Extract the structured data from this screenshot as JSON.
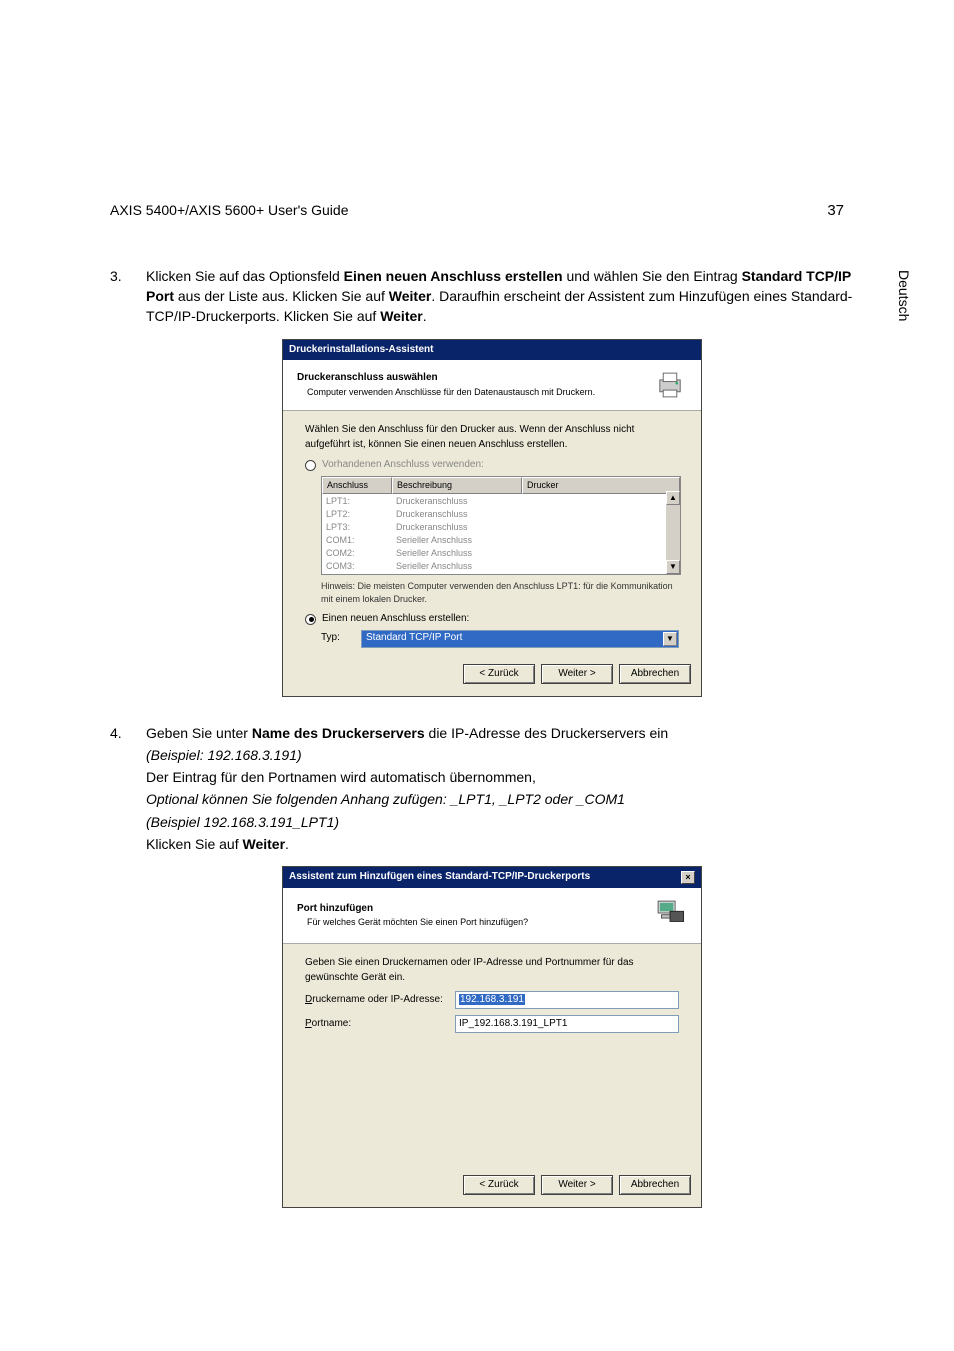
{
  "header": {
    "title": "AXIS 5400+/AXIS 5600+ User's Guide",
    "page_number": "37",
    "side_label": "Deutsch"
  },
  "step3": {
    "number": "3.",
    "text_before_bold1": "Klicken Sie auf das Optionsfeld ",
    "bold1": "Einen neuen Anschluss erstellen",
    "text_mid1": " und wählen Sie den Eintrag ",
    "bold2": "Standard TCP/IP Port",
    "text_mid2": " aus der Liste aus. Klicken Sie auf ",
    "bold3": "Weiter",
    "text_mid3": ". Daraufhin erscheint der Assistent zum Hinzufügen eines Standard-TCP/IP-Druckerports. Klicken Sie auf ",
    "bold4": "Weiter",
    "text_end": "."
  },
  "dialog1": {
    "title": "Druckerinstallations-Assistent",
    "heading": "Druckeranschluss auswählen",
    "subheading": "Computer verwenden Anschlüsse für den Datenaustausch mit Druckern.",
    "intro": "Wählen Sie den Anschluss für den Drucker aus. Wenn der Anschluss nicht aufgeführt ist, können Sie einen neuen Anschluss erstellen.",
    "radio_existing": "Vorhandenen Anschluss verwenden:",
    "table": {
      "col1": "Anschluss",
      "col2": "Beschreibung",
      "col3": "Drucker",
      "rows": [
        {
          "c1": "LPT1:",
          "c2": "Druckeranschluss"
        },
        {
          "c1": "LPT2:",
          "c2": "Druckeranschluss"
        },
        {
          "c1": "LPT3:",
          "c2": "Druckeranschluss"
        },
        {
          "c1": "COM1:",
          "c2": "Serieller Anschluss"
        },
        {
          "c1": "COM2:",
          "c2": "Serieller Anschluss"
        },
        {
          "c1": "COM3:",
          "c2": "Serieller Anschluss"
        }
      ]
    },
    "hint": "Hinweis: Die meisten Computer verwenden den Anschluss LPT1: für die Kommunikation mit einem lokalen Drucker.",
    "radio_new": "Einen neuen Anschluss erstellen:",
    "type_label": "Typ:",
    "type_value": "Standard TCP/IP Port",
    "btn_back": "< Zurück",
    "btn_next": "Weiter >",
    "btn_cancel": "Abbrechen"
  },
  "step4": {
    "number": "4.",
    "line1_a": "Geben Sie unter ",
    "line1_bold": "Name des Druckerservers",
    "line1_b": " die IP-Adresse des Druckerservers ein",
    "line2_italic": "(Beispiel: 192.168.3.191)",
    "line3": "Der Eintrag für den Portnamen wird automatisch übernommen,",
    "line4_italic": "Optional können Sie folgenden Anhang zufügen: _LPT1, _LPT2 oder _COM1",
    "line5_italic": "(Beispiel 192.168.3.191_LPT1)",
    "line6_a": "Klicken Sie auf ",
    "line6_bold": "Weiter",
    "line6_b": "."
  },
  "dialog2": {
    "title": "Assistent zum Hinzufügen eines Standard-TCP/IP-Druckerports",
    "heading": "Port hinzufügen",
    "subheading": "Für welches Gerät möchten Sie einen Port hinzufügen?",
    "intro": "Geben Sie einen Druckernamen oder IP-Adresse und Portnummer für das gewünschte Gerät ein.",
    "label_ip_u": "D",
    "label_ip_rest": "ruckername oder IP-Adresse:",
    "ip_value": "192.168.3.191",
    "label_port_u": "P",
    "label_port_rest": "ortname:",
    "port_value": "IP_192.168.3.191_LPT1",
    "btn_back": "< Zurück",
    "btn_next": "Weiter >",
    "btn_cancel": "Abbrechen"
  }
}
